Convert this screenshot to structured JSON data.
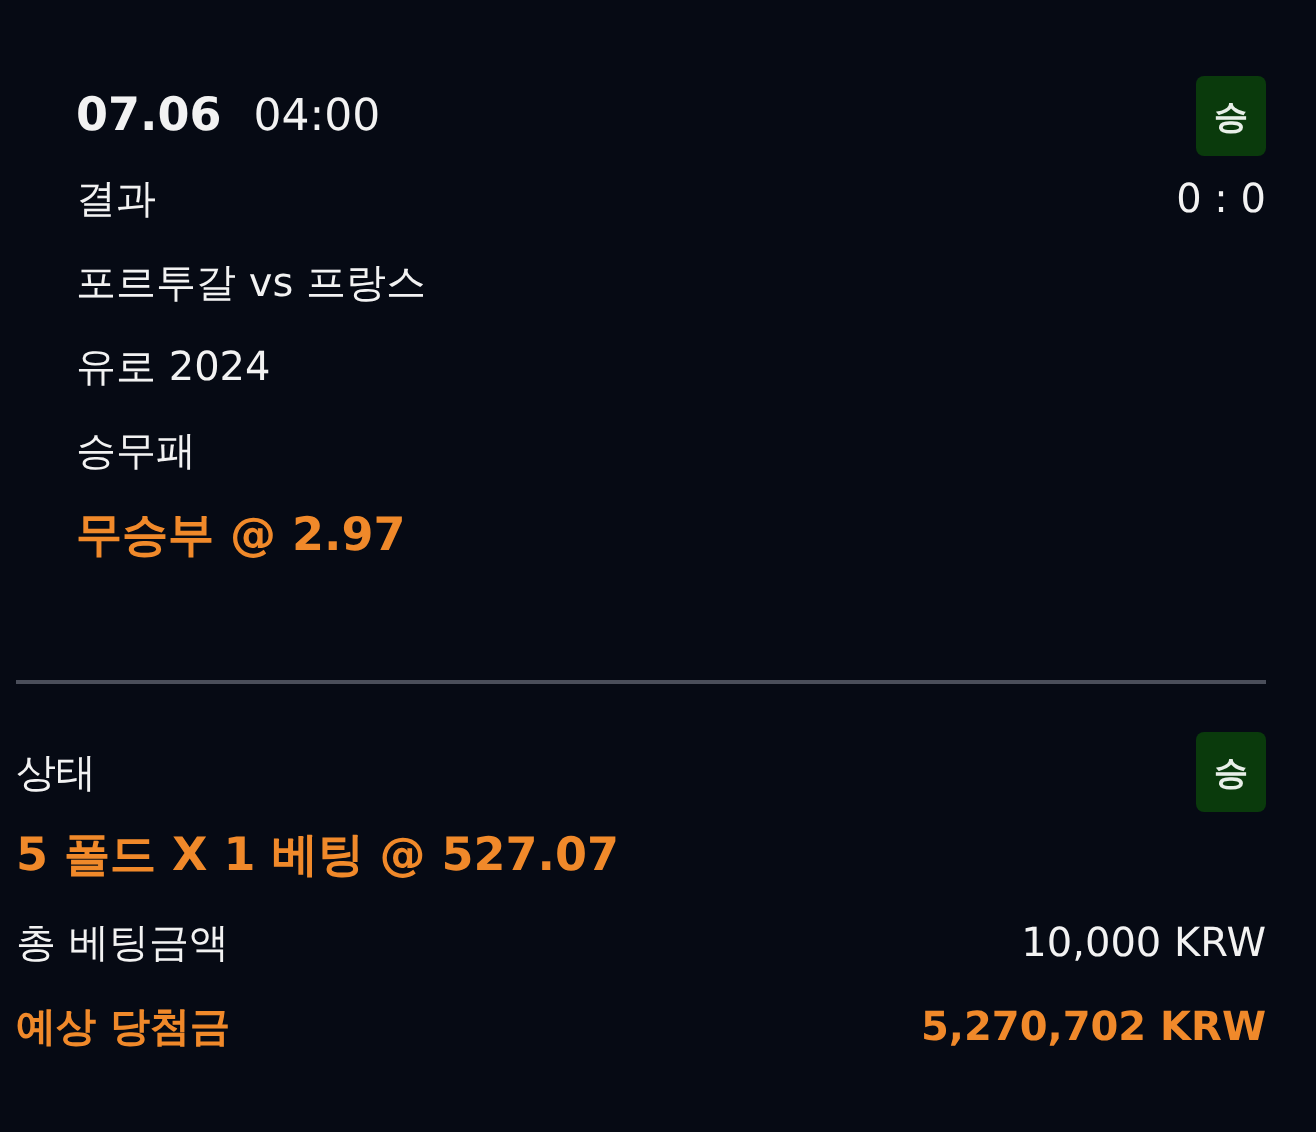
{
  "match": {
    "date": "07.06",
    "time": "04:00",
    "result_badge": "승",
    "result_label": "결과",
    "score": "0 : 0",
    "teams": "포르투갈 vs 프랑스",
    "league": "유로 2024",
    "market": "승무패",
    "pick": "무승부 @ 2.97"
  },
  "summary": {
    "status_label": "상태",
    "status_badge": "승",
    "bet": "5 폴드 X 1 베팅 @ 527.07",
    "rows": [
      {
        "label": "총 베팅금액",
        "value": "10,000 KRW",
        "highlight": false
      },
      {
        "label": "예상 당첨금",
        "value": "5,270,702 KRW",
        "highlight": true
      }
    ]
  }
}
